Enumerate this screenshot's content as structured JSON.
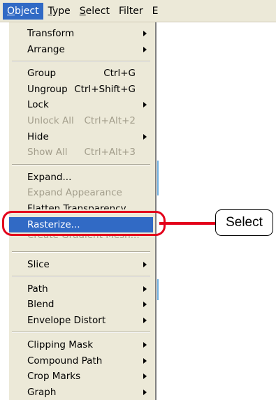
{
  "menubar": [
    {
      "label": "Object",
      "underline": "O",
      "rest": "bject",
      "active": true
    },
    {
      "label": "Type",
      "underline": "T",
      "rest": "ype",
      "active": false
    },
    {
      "label": "Select",
      "underline": "S",
      "rest": "elect",
      "active": false
    },
    {
      "label": "Filter",
      "underline": "",
      "rest": "Filter",
      "active": false
    },
    {
      "label": "E",
      "underline": "E",
      "rest": "",
      "active": false
    }
  ],
  "menu": {
    "transform": "Transform",
    "arrange": "Arrange",
    "group": "Group",
    "group_shortcut": "Ctrl+G",
    "ungroup": "Ungroup",
    "ungroup_shortcut": "Ctrl+Shift+G",
    "lock": "Lock",
    "unlock_all": "Unlock All",
    "unlock_all_shortcut": "Ctrl+Alt+2",
    "hide": "Hide",
    "show_all": "Show All",
    "show_all_shortcut": "Ctrl+Alt+3",
    "expand": "Expand...",
    "expand_appearance": "Expand Appearance",
    "flatten_transparency": "Flatten Transparency...",
    "rasterize": "Rasterize...",
    "create_gradient_mesh": "Create Gradient Mesh...",
    "slice": "Slice",
    "path": "Path",
    "blend": "Blend",
    "envelope_distort": "Envelope Distort",
    "clipping_mask": "Clipping Mask",
    "compound_path": "Compound Path",
    "crop_marks": "Crop Marks",
    "graph": "Graph"
  },
  "callout": {
    "label": "Select"
  },
  "colors": {
    "highlight": "#316ac5",
    "callout": "#e3001b",
    "menu_bg": "#ece9d8"
  }
}
